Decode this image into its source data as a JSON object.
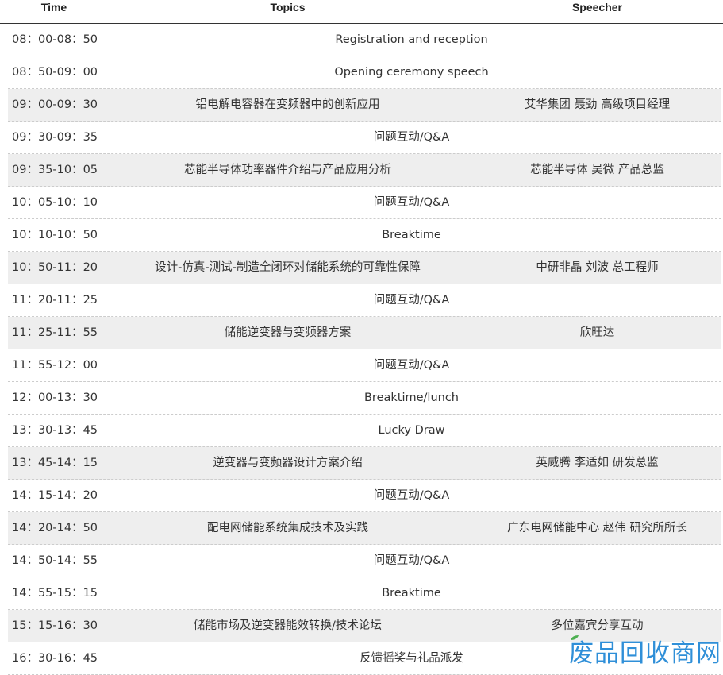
{
  "header": {
    "time": "Time",
    "topics": "Topics",
    "speecher": "Speecher"
  },
  "rows": [
    {
      "time": "08：00-08：50",
      "topic": "Registration and reception",
      "speaker": "",
      "shaded": false
    },
    {
      "time": "08：50-09：00",
      "topic": "Opening ceremony speech",
      "speaker": "",
      "shaded": false
    },
    {
      "time": "09：00-09：30",
      "topic": "铝电解电容器在变频器中的创新应用",
      "speaker": "艾华集团 聂劲 高级项目经理",
      "shaded": true
    },
    {
      "time": "09：30-09：35",
      "topic": "问题互动/Q&A",
      "speaker": "",
      "shaded": false
    },
    {
      "time": "09：35-10：05",
      "topic": "芯能半导体功率器件介绍与产品应用分析",
      "speaker": "芯能半导体 吴微 产品总监",
      "shaded": true
    },
    {
      "time": "10：05-10：10",
      "topic": "问题互动/Q&A",
      "speaker": "",
      "shaded": false
    },
    {
      "time": "10：10-10：50",
      "topic": "Breaktime",
      "speaker": "",
      "shaded": false
    },
    {
      "time": "10：50-11：20",
      "topic": "设计-仿真-测试-制造全闭环对储能系统的可靠性保障",
      "speaker": "中研非晶 刘波 总工程师",
      "shaded": true
    },
    {
      "time": "11：20-11：25",
      "topic": "问题互动/Q&A",
      "speaker": "",
      "shaded": false
    },
    {
      "time": "11：25-11：55",
      "topic": "储能逆变器与变频器方案",
      "speaker": "欣旺达",
      "shaded": true
    },
    {
      "time": "11：55-12：00",
      "topic": "问题互动/Q&A",
      "speaker": "",
      "shaded": false
    },
    {
      "time": "12：00-13：30",
      "topic": "Breaktime/lunch",
      "speaker": "",
      "shaded": false
    },
    {
      "time": "13：30-13：45",
      "topic": "Lucky Draw",
      "speaker": "",
      "shaded": false
    },
    {
      "time": "13：45-14：15",
      "topic": "逆变器与变频器设计方案介绍",
      "speaker": "英威腾 李适如 研发总监",
      "shaded": true
    },
    {
      "time": "14：15-14：20",
      "topic": "问题互动/Q&A",
      "speaker": "",
      "shaded": false
    },
    {
      "time": "14：20-14：50",
      "topic": "配电网储能系统集成技术及实践",
      "speaker": "广东电网储能中心 赵伟 研究所所长",
      "shaded": true
    },
    {
      "time": "14：50-14：55",
      "topic": "问题互动/Q&A",
      "speaker": "",
      "shaded": false
    },
    {
      "time": "14：55-15：15",
      "topic": "Breaktime",
      "speaker": "",
      "shaded": false
    },
    {
      "time": "15：15-16：30",
      "topic": "储能市场及逆变器能效转换/技术论坛",
      "speaker": "多位嘉宾分享互动",
      "shaded": true
    },
    {
      "time": "16：30-16：45",
      "topic": "反馈摇奖与礼品派发",
      "speaker": "",
      "shaded": false
    }
  ],
  "watermark": {
    "text": "废品回收商网",
    "color": "#2f8fd8",
    "leaf_color": "#4caf50"
  },
  "colors": {
    "shaded_row": "#eeeeee",
    "divider": "#cccccc",
    "text": "#333333"
  }
}
